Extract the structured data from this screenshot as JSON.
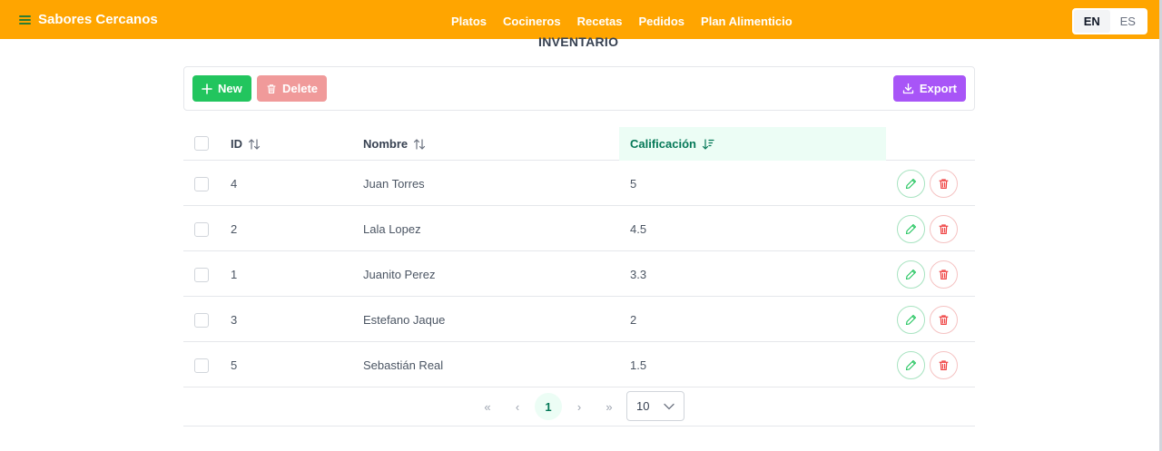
{
  "header": {
    "brand": "Sabores Cercanos",
    "nav": [
      "Platos",
      "Cocineros",
      "Recetas",
      "Pedidos",
      "Plan Alimenticio"
    ],
    "lang": {
      "active": "EN",
      "inactive": "ES"
    }
  },
  "page_title": "INVENTARIO",
  "toolbar": {
    "new_label": "New",
    "delete_label": "Delete",
    "export_label": "Export"
  },
  "table": {
    "columns": {
      "id": "ID",
      "name": "Nombre",
      "rating": "Calificación"
    },
    "rows": [
      {
        "id": "4",
        "name": "Juan Torres",
        "rating": "5"
      },
      {
        "id": "2",
        "name": "Lala Lopez",
        "rating": "4.5"
      },
      {
        "id": "1",
        "name": "Juanito Perez",
        "rating": "3.3"
      },
      {
        "id": "3",
        "name": "Estefano Jaque",
        "rating": "2"
      },
      {
        "id": "5",
        "name": "Sebastián Real",
        "rating": "1.5"
      }
    ]
  },
  "paginator": {
    "current_page": "1",
    "rows_per_page": "10"
  },
  "colors": {
    "header": "#ffa500",
    "new": "#22c55e",
    "delete": "#f09a9a",
    "export": "#a855f7",
    "accent": "#047857"
  }
}
